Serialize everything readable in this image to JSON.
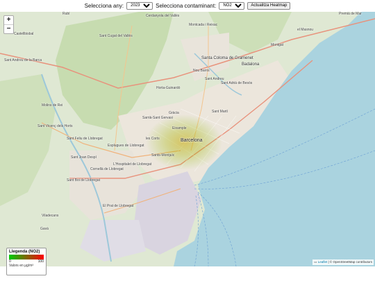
{
  "controls": {
    "year_label": "Selecciona any:",
    "year_value": "2023",
    "pollutant_label": "Selecciona contaminant:",
    "pollutant_value": "NO2",
    "update_button": "Actualitza Heatmap"
  },
  "zoom": {
    "in": "+",
    "out": "−"
  },
  "legend": {
    "title": "Llegenda (NO2)",
    "min": "0",
    "max": "100",
    "unit": "Valors en µg/m³",
    "color_low": "#00cc00",
    "color_high": "#ff0000"
  },
  "attribution": {
    "leaflet": "Leaflet",
    "osm": "| © OpenStreetMap contributors"
  },
  "places": [
    {
      "id": "rubi",
      "name": "Rubí"
    },
    {
      "id": "cerdanyola",
      "name": "Cerdanyola del Vallès"
    },
    {
      "id": "montcada",
      "name": "Montcada i Reixac"
    },
    {
      "id": "premia",
      "name": "Premià de Mar"
    },
    {
      "id": "castellbisbal",
      "name": "Castellbisbal"
    },
    {
      "id": "santcugat",
      "name": "Sant Cugat del Vallès"
    },
    {
      "id": "elmasnou",
      "name": "el Masnou"
    },
    {
      "id": "montgat",
      "name": "Montgat"
    },
    {
      "id": "santandreubarca",
      "name": "Sant Andreu de la Barca"
    },
    {
      "id": "santacoloma",
      "name": "Santa Coloma de Gramenet"
    },
    {
      "id": "badalona",
      "name": "Badalona"
    },
    {
      "id": "santadria",
      "name": "Sant Adrià de Besòs"
    },
    {
      "id": "horta",
      "name": "Horta-Guinardó"
    },
    {
      "id": "molins",
      "name": "Molins de Rei"
    },
    {
      "id": "santvicenc",
      "name": "Sant Vicenç dels Horts"
    },
    {
      "id": "santfeliu",
      "name": "Sant Feliu de Llobregat"
    },
    {
      "id": "barcelona",
      "name": "Barcelona"
    },
    {
      "id": "sarria",
      "name": "Sarrià-Sant Gervasi"
    },
    {
      "id": "santjoan",
      "name": "Sant Joan Despí"
    },
    {
      "id": "esplugues",
      "name": "Esplugues de Llobregat"
    },
    {
      "id": "lhospitalet",
      "name": "L'Hospitalet de Llobregat"
    },
    {
      "id": "cornella",
      "name": "Cornellà de Llobregat"
    },
    {
      "id": "santboi",
      "name": "Sant Boi de Llobregat"
    },
    {
      "id": "elprat",
      "name": "El Prat de Llobregat"
    },
    {
      "id": "viladecans",
      "name": "Viladecans"
    },
    {
      "id": "gava",
      "name": "Gavà"
    },
    {
      "id": "gracia",
      "name": "Gràcia"
    },
    {
      "id": "santmarti",
      "name": "Sant Martí"
    },
    {
      "id": "eixample",
      "name": "Eixample"
    },
    {
      "id": "santsmontjuic",
      "name": "Sants-Montjuïc"
    },
    {
      "id": "lescorts",
      "name": "les Corts"
    },
    {
      "id": "noubarris",
      "name": "Nou Barris"
    },
    {
      "id": "santandreu",
      "name": "Sant Andreu"
    }
  ]
}
